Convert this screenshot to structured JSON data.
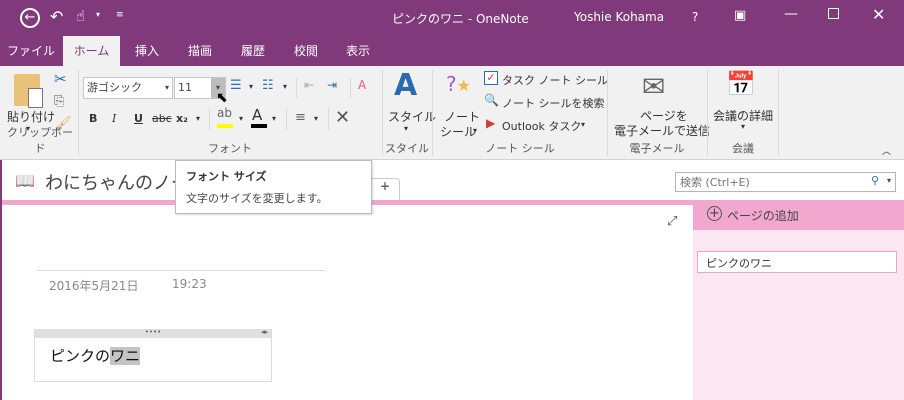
{
  "title_bar": {
    "title": "ピンクのワニ - OneNote",
    "user": "Yoshie Kohama",
    "help": "?",
    "back_icon": "back-icon",
    "undo_icon": "undo-icon",
    "touch_icon": "touch-mode-icon"
  },
  "tabs": [
    "ファイル",
    "ホーム",
    "挿入",
    "描画",
    "履歴",
    "校閲",
    "表示"
  ],
  "ribbon": {
    "clipboard": {
      "paste": "貼り付け",
      "group": "クリップボード"
    },
    "font": {
      "font_name": "游ゴシック",
      "font_size": "11",
      "bold": "B",
      "italic": "I",
      "underline": "U",
      "strike": "abc",
      "subscript": "x₂",
      "group": "フォント",
      "highlight_color": "#FFFF00",
      "font_color": "#000000"
    },
    "styles": {
      "label": "スタイル",
      "group": "スタイル"
    },
    "tags": {
      "tags_line1": "ノート",
      "tags_line2": "シール",
      "todo": "タスク ノート シール",
      "find": "ノート シールを検索",
      "outlook": "Outlook タスク",
      "group": "ノート シール"
    },
    "email": {
      "line1": "ページを",
      "line2": "電子メールで送信",
      "group": "電子メール"
    },
    "meetings": {
      "label": "会議の詳細",
      "group": "会議"
    }
  },
  "tooltip": {
    "title": "フォント サイズ",
    "body": "文字のサイズを変更します。"
  },
  "notebook": {
    "name": "わにちゃんのノート",
    "add_tab": "+"
  },
  "search": {
    "placeholder": "検索 (Ctrl+E)"
  },
  "page": {
    "date": "2016年5月21日",
    "time": "19:23",
    "note_plain": "ピンクの",
    "note_selected": "ワニ"
  },
  "pages_panel": {
    "add_page": "ページの追加",
    "pages": [
      "ピンクのワニ"
    ]
  }
}
